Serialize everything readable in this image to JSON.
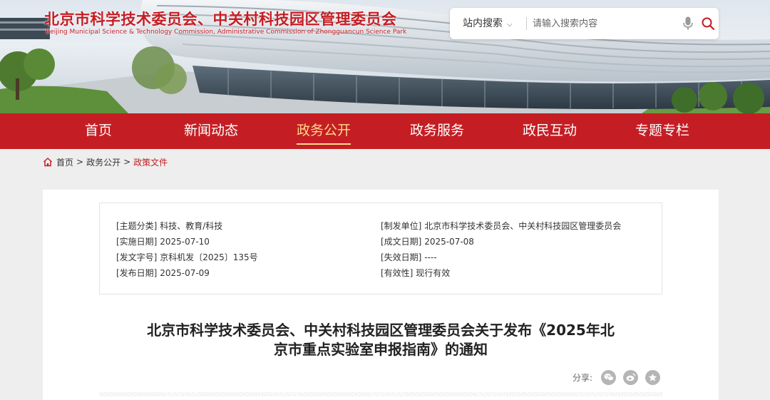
{
  "header": {
    "title_cn": "北京市科学技术委员会、中关村科技园区管理委员会",
    "title_en": "Beijing Municipal Science & Technology Commission, Administrative Commission of Zhongguancun Science Park"
  },
  "search": {
    "scope_label": "站内搜索",
    "placeholder": "请输入搜索内容",
    "scope_icon": "chevron-down-icon",
    "mic_icon": "microphone-icon",
    "submit_icon": "search-icon"
  },
  "nav": {
    "items": [
      {
        "label": "首页"
      },
      {
        "label": "新闻动态"
      },
      {
        "label": "政务公开"
      },
      {
        "label": "政务服务"
      },
      {
        "label": "政民互动"
      },
      {
        "label": "专题专栏"
      }
    ],
    "active_index": 2
  },
  "breadcrumb": {
    "icon": "home-icon",
    "items": [
      "首页",
      "政务公开",
      "政策文件"
    ],
    "separator": ">"
  },
  "meta": {
    "left": [
      {
        "key": "[主题分类]",
        "value": "科技、教育/科技"
      },
      {
        "key": "[实施日期]",
        "value": "2025-07-10"
      },
      {
        "key": "[发文字号]",
        "value": "京科机发〔2025〕135号"
      },
      {
        "key": "[发布日期]",
        "value": "2025-07-09"
      }
    ],
    "right": [
      {
        "key": "[制发单位]",
        "value": "北京市科学技术委员会、中关村科技园区管理委员会"
      },
      {
        "key": "[成文日期]",
        "value": "2025-07-08"
      },
      {
        "key": "[失效日期]",
        "value": "----"
      },
      {
        "key": "[有效性]",
        "value": "现行有效"
      }
    ]
  },
  "document": {
    "title_line1": "北京市科学技术委员会、中关村科技园区管理委员会关于发布《2025年北",
    "title_line2": "京市重点实验室申报指南》的通知"
  },
  "share": {
    "label": "分享:",
    "buttons": [
      "wechat-icon",
      "weibo-icon",
      "favorite-icon"
    ]
  },
  "colors": {
    "brand_red": "#c41e24",
    "nav_active": "#ffd98a",
    "page_bg": "#eeeeee"
  }
}
